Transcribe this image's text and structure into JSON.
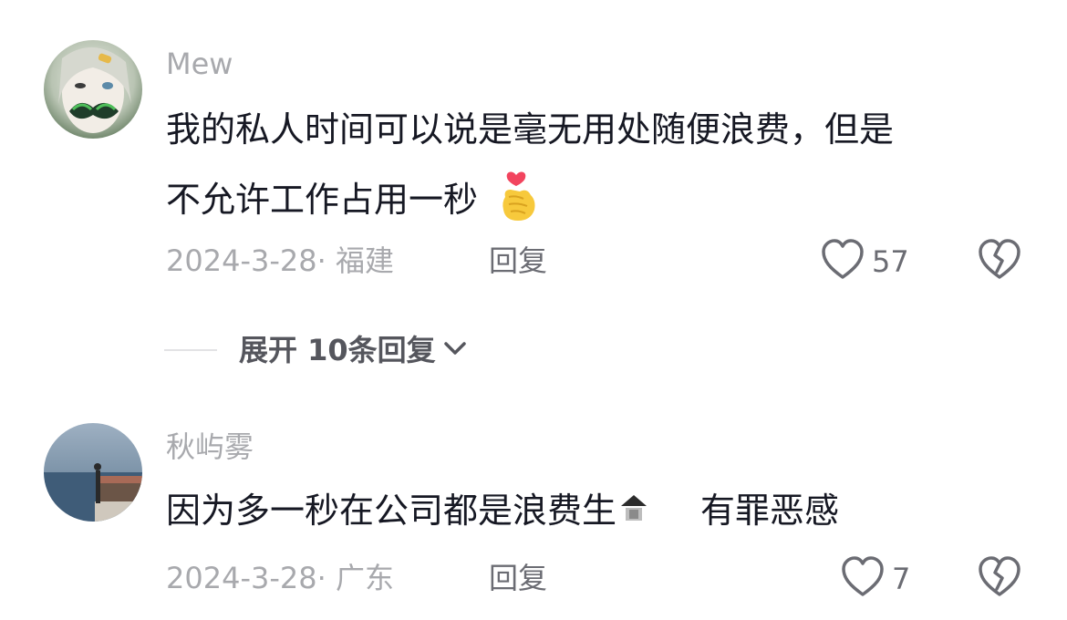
{
  "comments": [
    {
      "username": "Mew",
      "text_line1": "我的私人时间可以说是毫无用处随便浪费，但是",
      "text_line2": "不允许工作占用一秒",
      "date_location": "2024-3-28· 福建",
      "reply_label": "回复",
      "like_count": "57"
    },
    {
      "username": "秋屿雾",
      "text_part1": "因为多一秒在公司都是浪费生",
      "text_part2": "有罪恶感",
      "date_location": "2024-3-28· 广东",
      "reply_label": "回复",
      "like_count": "7"
    }
  ],
  "expand_replies": {
    "label": "展开 10条回复"
  },
  "icons": {
    "like": "heart-outline-icon",
    "dislike": "broken-heart-icon",
    "expand": "chevron-down-icon",
    "emoji": "finger-heart-emoji"
  },
  "colors": {
    "text_primary": "#161823",
    "text_secondary": "#a8a9ad",
    "text_action": "#6b6c73"
  }
}
